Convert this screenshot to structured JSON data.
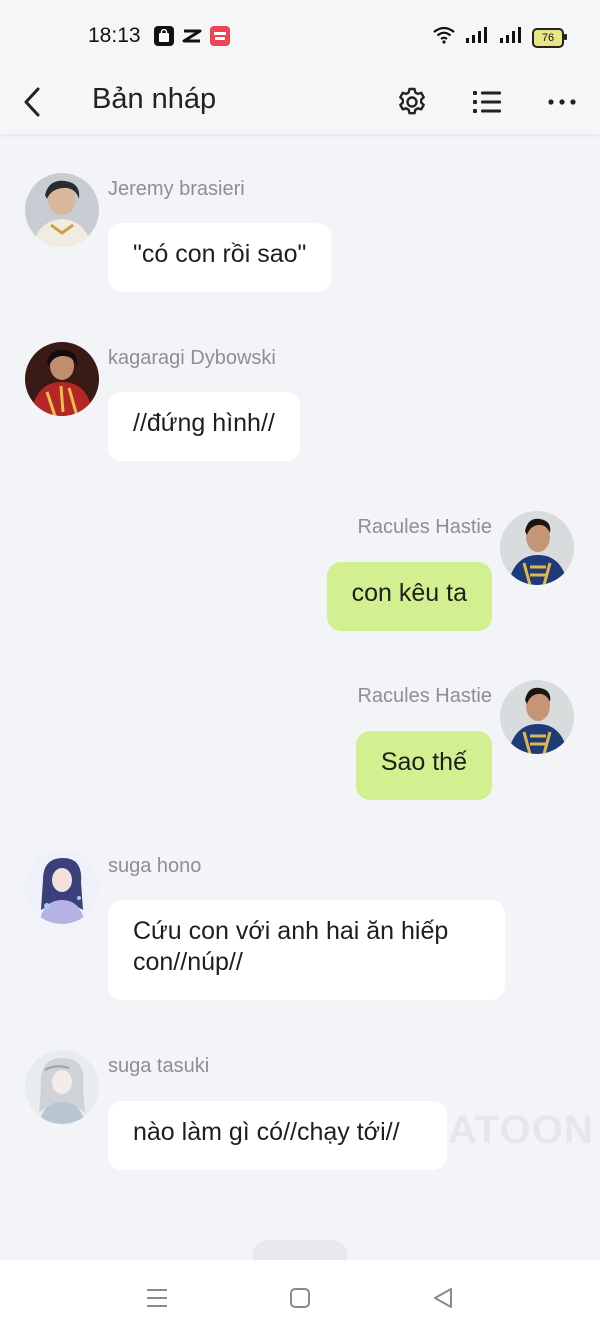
{
  "status_bar": {
    "time": "18:13",
    "battery": "76",
    "app_icons": [
      "shopping-bag-icon",
      "capcut-icon",
      "mangatoon-icon"
    ]
  },
  "app_bar": {
    "title": "Bản nháp",
    "icons": [
      "back-icon",
      "gear-icon",
      "list-icon",
      "more-icon"
    ]
  },
  "messages": [
    {
      "side": "left",
      "sender": "Jeremy brasieri",
      "lines": [
        "\"có con rồi sao\""
      ]
    },
    {
      "side": "left",
      "sender": "kagaragi Dybowski",
      "lines": [
        "//đứng hình//"
      ]
    },
    {
      "side": "right",
      "sender": "Racules Hastie",
      "lines": [
        "con kêu ta"
      ]
    },
    {
      "side": "right",
      "sender": "Racules Hastie",
      "lines": [
        "Sao thế"
      ]
    },
    {
      "side": "left",
      "sender": "suga hono",
      "lines": [
        "Cứu con với anh hai ăn hiếp",
        "con//núp//"
      ]
    },
    {
      "side": "left",
      "sender": "suga tasuki",
      "lines": [
        "nào làm gì có//chạy tới//"
      ]
    }
  ],
  "watermark": "ATOON",
  "colors": {
    "background": "#f3f4f8",
    "bubble_left": "#ffffff",
    "bubble_right": "#d2f08f",
    "name_text": "#8e8e93"
  },
  "nav_bar": {
    "icons": [
      "menu-icon",
      "home-square-icon",
      "back-triangle-icon"
    ]
  }
}
